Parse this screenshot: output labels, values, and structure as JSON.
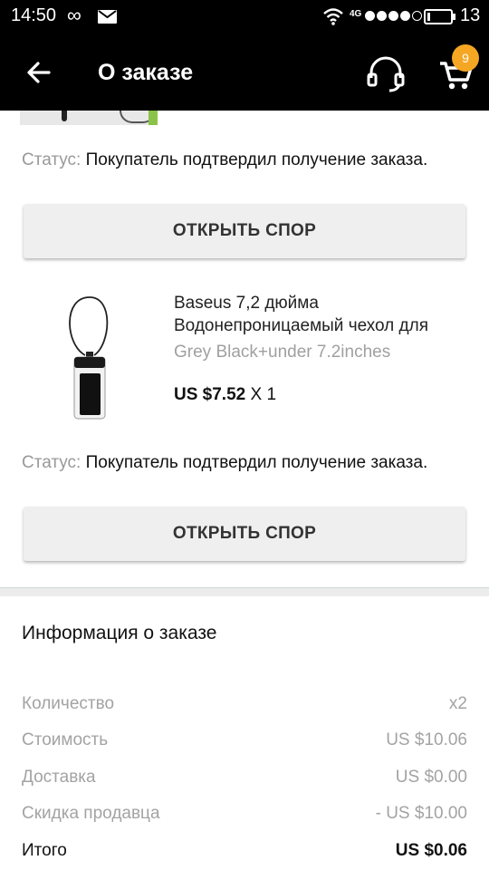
{
  "status_bar": {
    "time": "14:50",
    "infinity": "∞",
    "network_type": "4G",
    "battery_percent": "13",
    "battery_level": 0.13
  },
  "app_bar": {
    "title": "О заказе",
    "cart_badge": "9"
  },
  "colors": {
    "badge": "#f5a623",
    "app_bar_bg": "#000000"
  },
  "items": [
    {
      "status_label": "Статус:",
      "status_value": "Покупатель подтвердил получение заказа.",
      "dispute_button": "ОТКРЫТЬ СПОР"
    },
    {
      "name_line1": "Baseus 7,2 дюйма",
      "name_line2": "Водонепроницаемый чехол для",
      "variant": "Grey Black+under 7.2inches",
      "price": "US $7.52",
      "quantity": "X 1",
      "status_label": "Статус:",
      "status_value": "Покупатель подтвердил получение заказа.",
      "dispute_button": "ОТКРЫТЬ СПОР"
    }
  ],
  "order_info": {
    "title": "Информация о заказе",
    "rows": [
      {
        "label": "Количество",
        "value": "x2"
      },
      {
        "label": "Стоимость",
        "value": "US $10.06"
      },
      {
        "label": "Доставка",
        "value": "US $0.00"
      },
      {
        "label": "Скидка продавца",
        "value": "- US $10.00"
      },
      {
        "label": "Итого",
        "value": "US $0.06"
      }
    ]
  }
}
